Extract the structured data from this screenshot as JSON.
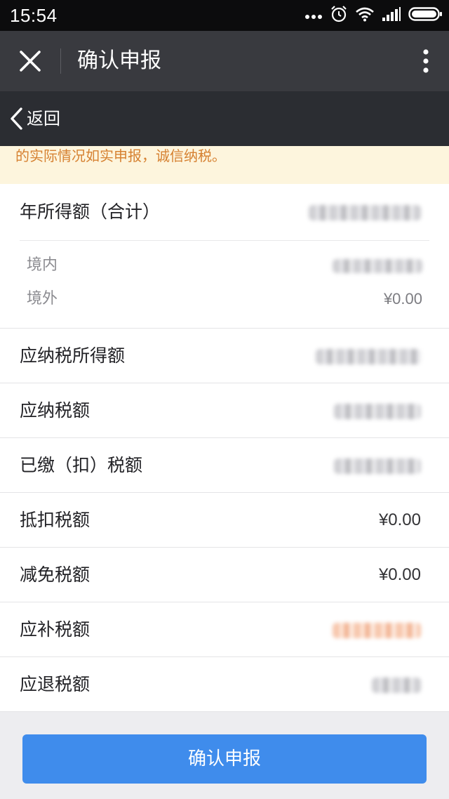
{
  "status_bar": {
    "time": "15:54",
    "icons": [
      "more-dots-icon",
      "alarm-icon",
      "wifi-icon",
      "signal-icon",
      "battery-icon"
    ]
  },
  "header": {
    "title": "确认申报",
    "close_icon": "close-icon",
    "menu_icon": "more-vertical-icon"
  },
  "nav": {
    "back_label": "返回",
    "back_icon": "chevron-left-icon"
  },
  "notice": {
    "text": "的实际情况如实申报，诚信纳税。"
  },
  "summary": {
    "annual_income": {
      "label": "年所得额（合计）",
      "value": ""
    },
    "domestic": {
      "label": "境内",
      "value": ""
    },
    "overseas": {
      "label": "境外",
      "value": "¥0.00"
    }
  },
  "rows": [
    {
      "label": "应纳税所得额",
      "value": ""
    },
    {
      "label": "应纳税额",
      "value": ""
    },
    {
      "label": "已缴（扣）税额",
      "value": ""
    },
    {
      "label": "抵扣税额",
      "value": "¥0.00"
    },
    {
      "label": "减免税额",
      "value": "¥0.00"
    },
    {
      "label": "应补税额",
      "value": ""
    },
    {
      "label": "应退税额",
      "value": ""
    }
  ],
  "confirm_button": {
    "label": "确认申报"
  },
  "colors": {
    "title_bar": "#393a3f",
    "nav_bar": "#2b2d32",
    "notice_bg": "#fdf5dd",
    "notice_text": "#d68131",
    "primary": "#3f8cec"
  }
}
